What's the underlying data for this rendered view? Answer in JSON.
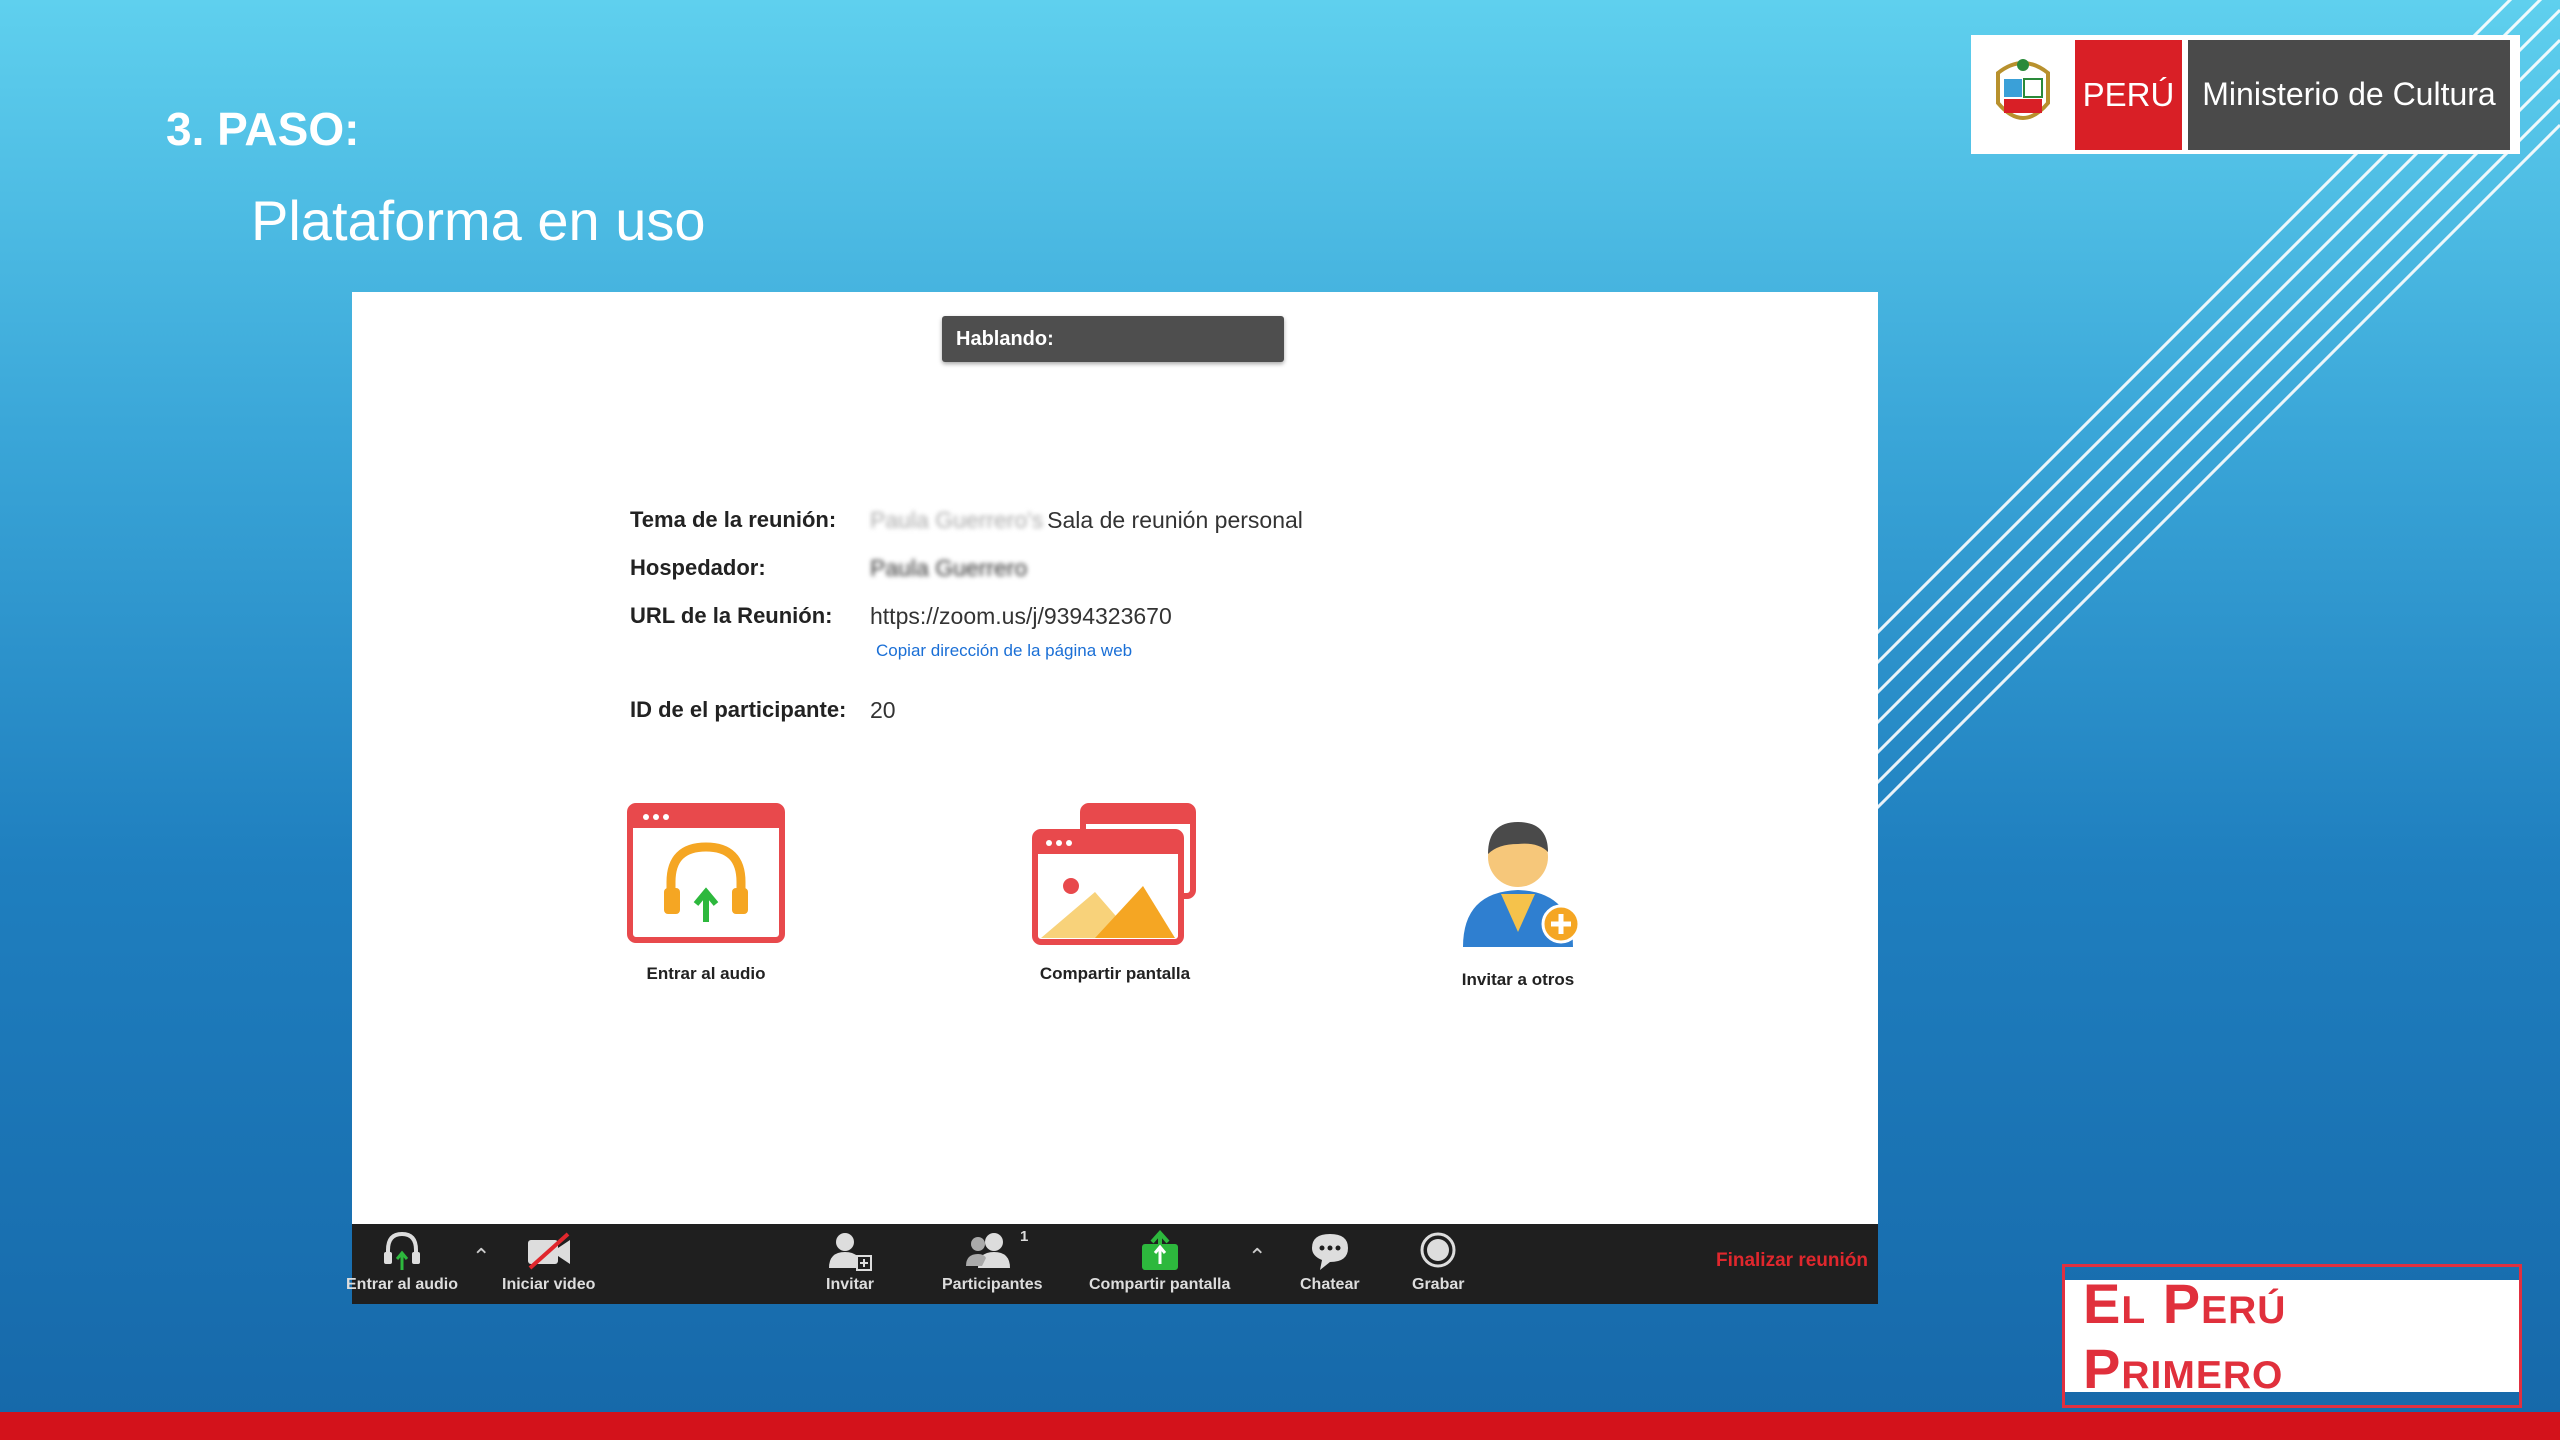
{
  "slide": {
    "step": "3. PASO:",
    "subtitle": "Plataforma en uso"
  },
  "logo_ministry": {
    "peru": "PERÚ",
    "ministry": "Ministerio de Cultura"
  },
  "logo_footer": {
    "text": "El Perú Primero"
  },
  "zoom": {
    "speaking_label": "Hablando:",
    "info": {
      "topic_label": "Tema de la reunión:",
      "topic_blurred": "Paula Guerrero's",
      "topic_value": "Sala de reunión personal",
      "host_label": "Hospedador:",
      "host_blurred": "Paula Guerrero",
      "url_label": "URL de la Reunión:",
      "url_value": "https://zoom.us/j/9394323670",
      "copy_link": "Copiar dirección de la página web",
      "participant_label": "ID de el participante:",
      "participant_value": "20"
    },
    "actions": [
      {
        "label": "Entrar al audio",
        "icon": "headphones-upload-icon"
      },
      {
        "label": "Compartir pantalla",
        "icon": "share-screen-icon"
      },
      {
        "label": "Invitar a otros",
        "icon": "invite-user-icon"
      }
    ],
    "toolbar": {
      "audio": "Entrar al audio",
      "video": "Iniciar video",
      "invite": "Invitar",
      "participants": "Participantes",
      "participants_count": "1",
      "share": "Compartir pantalla",
      "chat": "Chatear",
      "record": "Grabar",
      "end": "Finalizar reunión"
    }
  },
  "colors": {
    "zoom_orange": "#f5a623",
    "zoom_red_frame": "#e8494c",
    "end_red": "#e0272d",
    "toolbar_bg": "#1f1f1f",
    "share_green": "#2db83d"
  }
}
